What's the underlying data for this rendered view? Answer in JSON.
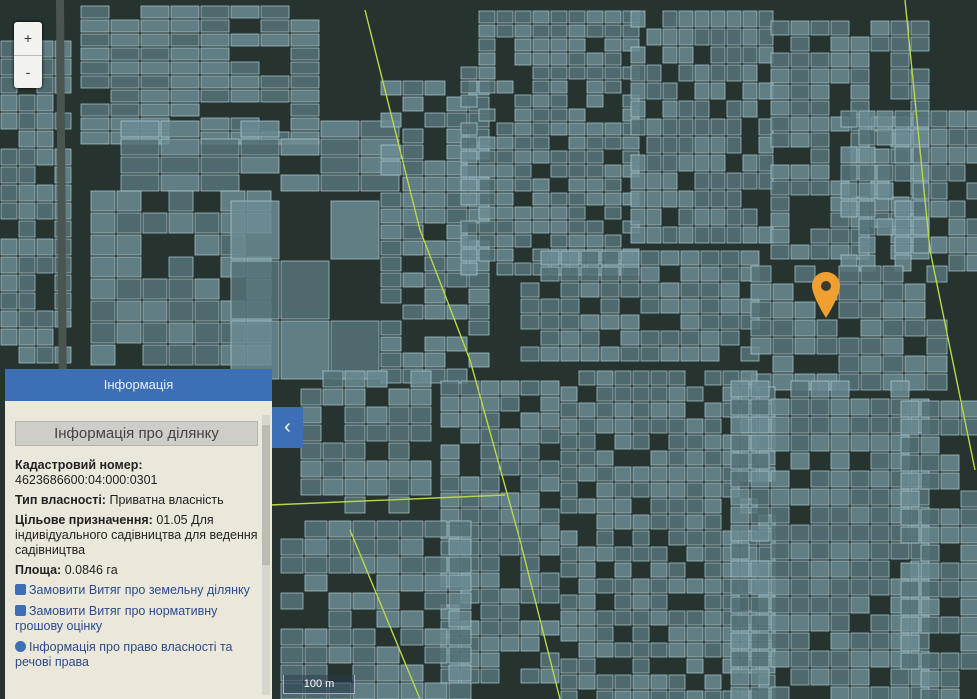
{
  "map": {
    "zoom_in": "+",
    "zoom_out": "-",
    "scale": "100 m",
    "marker_color": "#f0a030",
    "boundary_color": "#b8d84a"
  },
  "panel": {
    "header": "Інформація",
    "title": "Інформація про ділянку",
    "cadastral_label": "Кадастровий номер:",
    "cadastral_value": "4623686600:04:000:0301",
    "ownership_label": "Тип власності:",
    "ownership_value": "Приватна власність",
    "purpose_label": "Цільове призначення:",
    "purpose_value": "01.05 Для індивідуального садівництва для ведення садівництва",
    "area_label": "Площа:",
    "area_value": "0.0846 га",
    "links": [
      "Замовити Витяг про земельну ділянку",
      "Замовити Витяг про нормативну грошову оцінку",
      "Інформація про право власності та речові права"
    ],
    "collapse": "‹"
  }
}
